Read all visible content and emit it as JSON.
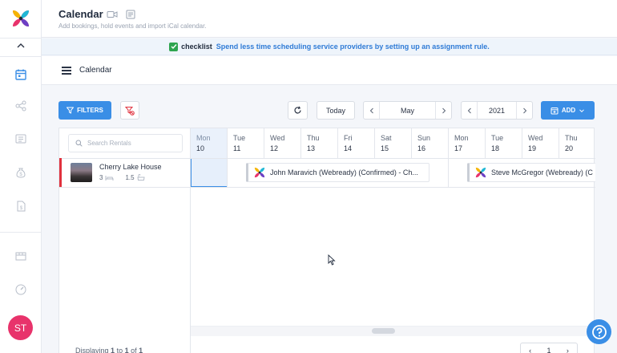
{
  "header": {
    "title": "Calendar",
    "subtitle": "Add bookings, hold events and import iCal calendar."
  },
  "banner": {
    "brand": "checklist",
    "message": "Spend less time scheduling service providers by setting up an assignment rule."
  },
  "calendar_bar": {
    "title": "Calendar"
  },
  "toolbar": {
    "filters_label": "FILTERS",
    "today_label": "Today",
    "month": "May",
    "year": "2021",
    "add_label": "ADD"
  },
  "search": {
    "placeholder": "Search Rentals"
  },
  "rental": {
    "name": "Cherry Lake House",
    "beds": "3",
    "baths": "1.5"
  },
  "days": [
    {
      "name": "Mon",
      "date": "10"
    },
    {
      "name": "Tue",
      "date": "11"
    },
    {
      "name": "Wed",
      "date": "12"
    },
    {
      "name": "Thu",
      "date": "13"
    },
    {
      "name": "Fri",
      "date": "14"
    },
    {
      "name": "Sat",
      "date": "15"
    },
    {
      "name": "Sun",
      "date": "16"
    },
    {
      "name": "Mon",
      "date": "17"
    },
    {
      "name": "Tue",
      "date": "18"
    },
    {
      "name": "Wed",
      "date": "19"
    },
    {
      "name": "Thu",
      "date": "20"
    }
  ],
  "bookings": [
    {
      "label": "John Maravich (Webready) (Confirmed) - Ch..."
    },
    {
      "label": "Steve McGregor (Webready) (C"
    }
  ],
  "footer": {
    "prefix": "Displaying",
    "from": "1",
    "to_word": "to",
    "to": "1",
    "of_word": "of",
    "total": "1"
  },
  "pager": {
    "page": "1"
  },
  "user": {
    "initials": "ST"
  },
  "colors": {
    "accent": "#3a8ee6",
    "rental_marker": "#e0313d",
    "avatar": "#e8336b",
    "checklist": "#2ea44f"
  }
}
